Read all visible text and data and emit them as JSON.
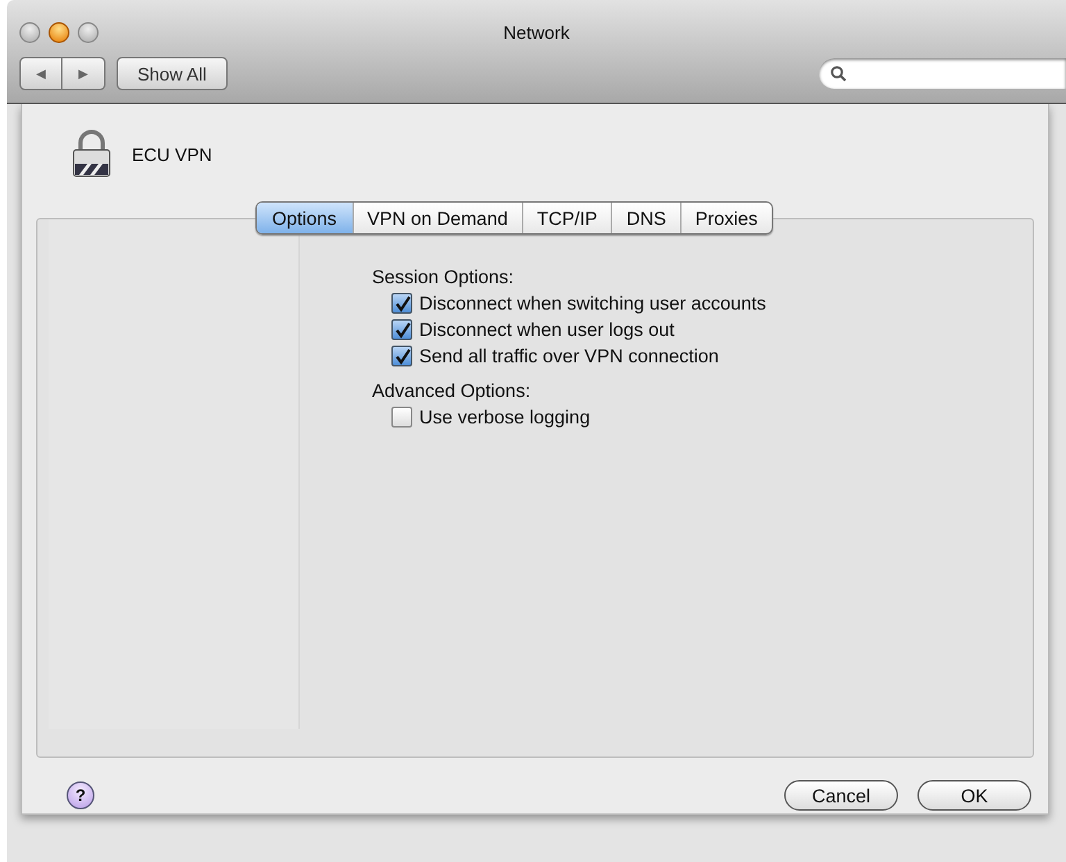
{
  "window": {
    "title": "Network"
  },
  "toolbar": {
    "back": "◀",
    "forward": "▶",
    "show_all": "Show All"
  },
  "sheet": {
    "service": "ECU VPN",
    "tabs": [
      {
        "label": "Options",
        "selected": true
      },
      {
        "label": "VPN on Demand",
        "selected": false
      },
      {
        "label": "TCP/IP",
        "selected": false
      },
      {
        "label": "DNS",
        "selected": false
      },
      {
        "label": "Proxies",
        "selected": false
      }
    ],
    "sections": [
      {
        "title": "Session Options:",
        "options": [
          {
            "label": "Disconnect when switching user accounts",
            "checked": true
          },
          {
            "label": "Disconnect when user logs out",
            "checked": true
          },
          {
            "label": "Send all traffic over VPN connection",
            "checked": true
          }
        ]
      },
      {
        "title": "Advanced Options:",
        "options": [
          {
            "label": "Use verbose logging",
            "checked": false
          }
        ]
      }
    ],
    "help": "?",
    "buttons": [
      "Cancel",
      "OK"
    ]
  }
}
